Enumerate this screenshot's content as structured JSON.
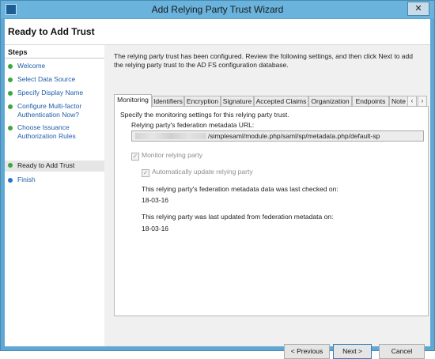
{
  "window": {
    "title": "Add Relying Party Trust Wizard",
    "close_glyph": "✕"
  },
  "header": {
    "title": "Ready to Add Trust"
  },
  "steps": {
    "heading": "Steps",
    "items": [
      {
        "label": "Welcome",
        "status": "complete"
      },
      {
        "label": "Select Data Source",
        "status": "complete"
      },
      {
        "label": "Specify Display Name",
        "status": "complete"
      },
      {
        "label": "Configure Multi-factor Authentication Now?",
        "status": "complete"
      },
      {
        "label": "Choose Issuance Authorization Rules",
        "status": "complete"
      },
      {
        "label": "Ready to Add Trust",
        "status": "current"
      },
      {
        "label": "Finish",
        "status": "pending"
      }
    ]
  },
  "main": {
    "description": "The relying party trust has been configured. Review the following settings, and then click Next to add the relying party trust to the AD FS configuration database.",
    "tabs": [
      "Monitoring",
      "Identifiers",
      "Encryption",
      "Signature",
      "Accepted Claims",
      "Organization",
      "Endpoints",
      "Note"
    ],
    "active_tab": "Monitoring",
    "tab_scroll_left": "‹",
    "tab_scroll_right": "›",
    "monitoring": {
      "intro": "Specify the monitoring settings for this relying party trust.",
      "url_label": "Relying party's federation metadata URL:",
      "url_value": "/simplesaml/module.php/saml/sp/metadata.php/default-sp",
      "monitor_checkbox_label": "Monitor relying party",
      "monitor_checked": true,
      "auto_update_checkbox_label": "Automatically update relying party",
      "auto_update_checked": true,
      "last_checked_label": "This relying party's federation metadata data was last checked on:",
      "last_checked_value": "18-03-16",
      "last_updated_label": "This relying party was last updated from federation metadata on:",
      "last_updated_value": "18-03-16"
    }
  },
  "buttons": {
    "previous": "< Previous",
    "next": "Next >",
    "cancel": "Cancel"
  },
  "colors": {
    "complete": "#3fa63f",
    "current": "#3fa63f",
    "pending": "#2a73c9",
    "titlebar": "#6ab3dd"
  }
}
